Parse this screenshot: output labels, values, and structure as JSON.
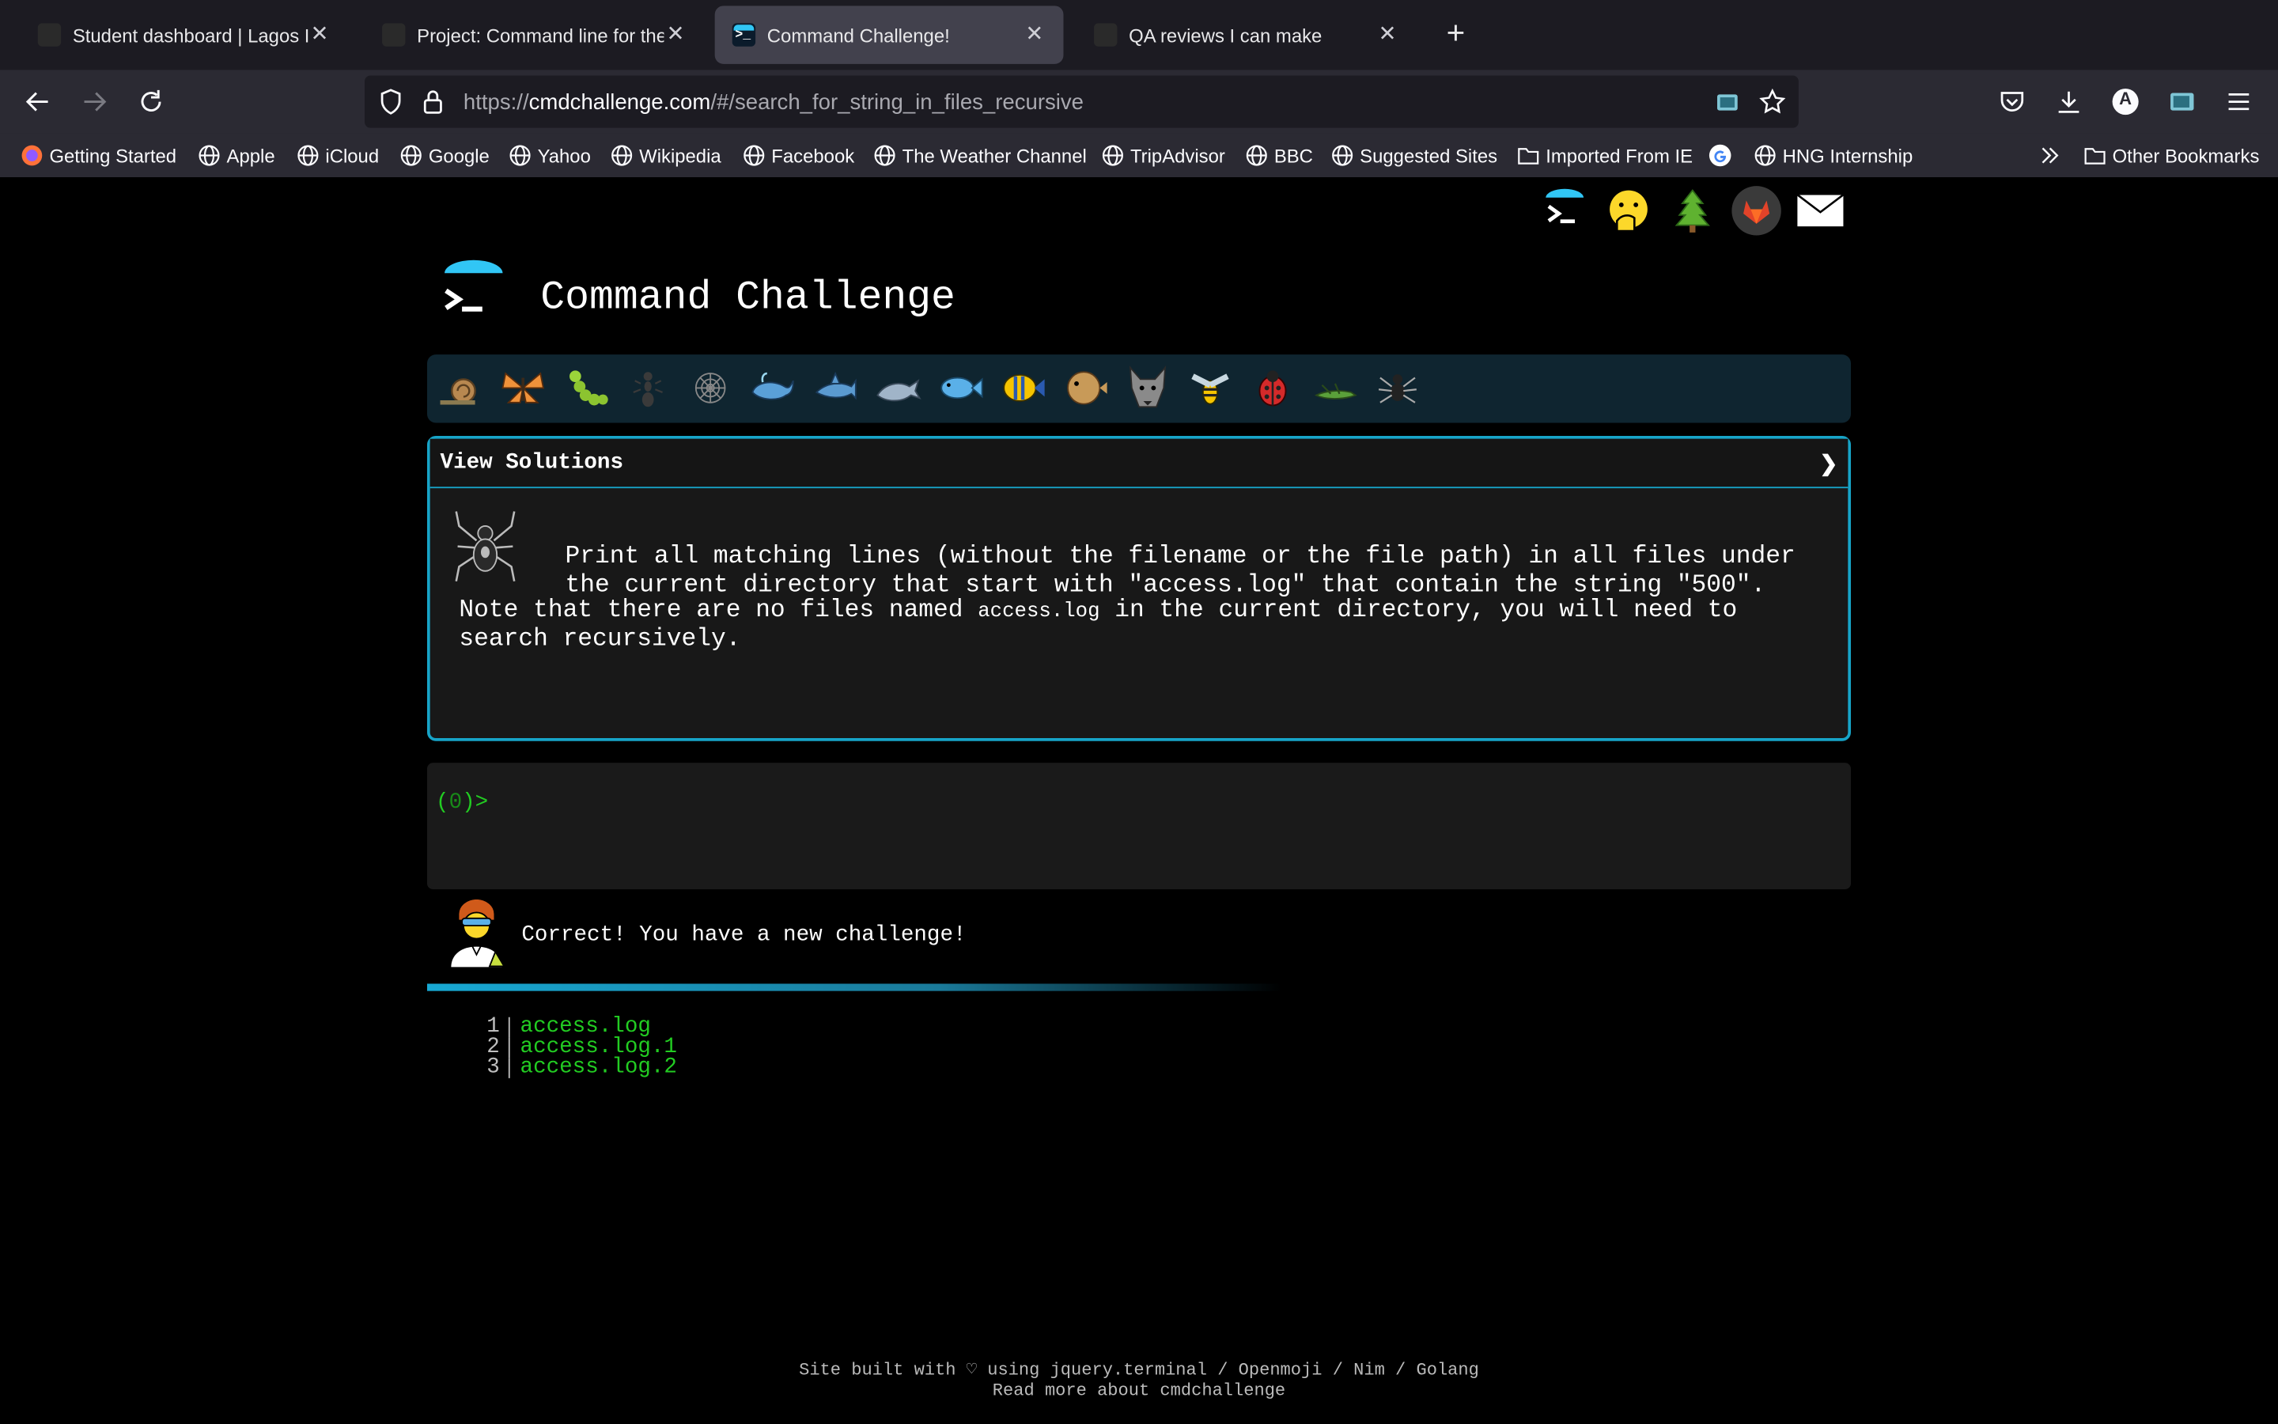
{
  "browser": {
    "tabs": [
      {
        "title": "Student dashboard | Lagos Intra",
        "active": false
      },
      {
        "title": "Project: Command line for the w",
        "active": false
      },
      {
        "title": "Command Challenge!",
        "active": true
      },
      {
        "title": "QA reviews I can make",
        "active": false
      }
    ],
    "url": {
      "scheme": "https://",
      "host": "cmdchallenge.com",
      "path": "/#/search_for_string_in_files_recursive"
    },
    "bookmarks": [
      {
        "label": "Getting Started",
        "icon": "firefox-icon"
      },
      {
        "label": "Apple",
        "icon": "globe-icon"
      },
      {
        "label": "iCloud",
        "icon": "globe-icon"
      },
      {
        "label": "Google",
        "icon": "globe-icon"
      },
      {
        "label": "Yahoo",
        "icon": "globe-icon"
      },
      {
        "label": "Wikipedia",
        "icon": "globe-icon"
      },
      {
        "label": "Facebook",
        "icon": "globe-icon"
      },
      {
        "label": "The Weather Channel",
        "icon": "globe-icon"
      },
      {
        "label": "TripAdvisor",
        "icon": "globe-icon"
      },
      {
        "label": "BBC",
        "icon": "globe-icon"
      },
      {
        "label": "Suggested Sites",
        "icon": "globe-icon"
      },
      {
        "label": "Imported From IE",
        "icon": "folder-icon"
      },
      {
        "label": "",
        "icon": "google-icon"
      },
      {
        "label": "HNG Internship",
        "icon": "globe-icon"
      }
    ],
    "other_bookmarks": "Other Bookmarks",
    "profile_letter": "A"
  },
  "page": {
    "title": "Command Challenge",
    "view_solutions": "View Solutions",
    "chevron": "❯",
    "task": "Print all matching lines (without the filename or the file path) in all files under the current directory that start with \"access.log\" that contain the string \"500\".",
    "note_before": "Note that there are no files named ",
    "note_code": "access.log",
    "note_after": " in the current directory, you will need to search recursively.",
    "prompt_open": "(",
    "prompt_num": "0",
    "prompt_close": ")>",
    "feedback": "Correct! You have a new challenge!",
    "progress_fraction": 0.6,
    "output": [
      {
        "n": "1",
        "file": "access.log"
      },
      {
        "n": "2",
        "file": "access.log.1"
      },
      {
        "n": "3",
        "file": "access.log.2"
      }
    ],
    "footer_line1": "Site built with ♡ using jquery.terminal / Openmoji / Nim / Golang",
    "footer_line2": "Read more about cmdchallenge"
  },
  "level_icons": [
    "snail-icon",
    "butterfly-icon",
    "caterpillar-icon",
    "ant-icon",
    "spider-web-icon",
    "whale-icon",
    "shark-icon",
    "dolphin-icon",
    "fish-icon",
    "tropical-fish-icon",
    "blowfish-icon",
    "wolf-icon",
    "bee-icon",
    "ladybug-icon",
    "cricket-icon",
    "spider-icon"
  ],
  "colors": {
    "accent": "#17a4c8",
    "terminal_green": "#22cc22",
    "tab_active": "#42414d"
  }
}
